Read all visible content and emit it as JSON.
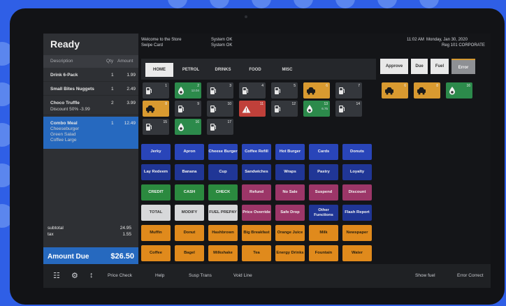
{
  "status": "Ready",
  "header": {
    "welcome": "Welcome to the Store",
    "swipe": "Swipe Card",
    "sys1": "System OK",
    "sys2": "System OK",
    "time": "11:02 AM",
    "date": "Monday, Jan 30, 2020",
    "register": "Reg 101 CORPORATE"
  },
  "receipt": {
    "columns": {
      "description": "Description",
      "qty": "Qty",
      "amount": "Amount"
    },
    "lines": [
      {
        "description": "Drink 6-Pack",
        "qty": "1",
        "amount": "1.99"
      },
      {
        "description": "Small Bites Nuggets",
        "qty": "1",
        "amount": "2.49"
      },
      {
        "description": "Choco Truffle",
        "sub": "Discount 50% -3.99",
        "qty": "2",
        "amount": "3.99"
      },
      {
        "description": "Combo Meal",
        "subs": [
          "Cheeseburger",
          "Green Salad",
          "Coffee Large"
        ],
        "qty": "1",
        "amount": "12.49"
      }
    ],
    "subtotal_label": "subtotal",
    "subtotal": "24.95",
    "tax_label": "tax",
    "tax": "1.55",
    "amount_due_label": "Amount Due",
    "amount_due": "$26.50"
  },
  "tabs": [
    "HOME",
    "PETROL",
    "DRINKS",
    "FOOD",
    "MISC"
  ],
  "pumps": [
    {
      "num": "1",
      "state": "idle"
    },
    {
      "num": "2",
      "amount": "12.04",
      "state": "green"
    },
    {
      "num": "3",
      "state": "idle"
    },
    {
      "num": "4",
      "state": "idle"
    },
    {
      "num": "5",
      "state": "idle"
    },
    {
      "num": "6",
      "state": "yellow"
    },
    {
      "num": "7",
      "state": "idle"
    },
    {
      "num": "8",
      "state": "yellow"
    },
    {
      "num": "9",
      "state": "idle"
    },
    {
      "num": "10",
      "state": "idle"
    },
    {
      "num": "11",
      "state": "red"
    },
    {
      "num": "12",
      "state": "idle"
    },
    {
      "num": "13",
      "amount": "6.75",
      "state": "green"
    },
    {
      "num": "14",
      "state": "idle"
    },
    {
      "num": "15",
      "state": "idle"
    },
    {
      "num": "16",
      "state": "green"
    },
    {
      "num": "17",
      "state": "idle"
    }
  ],
  "grid": {
    "row1": [
      "Jerky",
      "Apron",
      "Cheese Burger",
      "Coffee Refill",
      "Hot Burger",
      "Cards",
      "Donuts"
    ],
    "row2": [
      "Lay Redeem",
      "Banana",
      "Cup",
      "Sandwiches",
      "Wraps",
      "Pastry",
      "Loyalty"
    ],
    "row3": [
      "CREDIT",
      "CASH",
      "CHECK",
      "Refund",
      "No Sale",
      "Suspend",
      "Discount"
    ],
    "row4": [
      "TOTAL",
      "MODIFY",
      "FUEL PREPAY",
      "Price Override",
      "Safe Drop",
      "Other Functions",
      "Flash Report"
    ],
    "row5": [
      "Muffin",
      "Donut",
      "Hashbrown",
      "Big Breakfast",
      "Orange Juice",
      "Milk",
      "Newspaper"
    ],
    "row6": [
      "Coffee",
      "Bagel",
      "Milkshake",
      "Tea",
      "Energy Drinks",
      "Fountain",
      "Water"
    ]
  },
  "right_tabs": [
    "Approve",
    "Due",
    "Fuel",
    "Error"
  ],
  "right_pumps": [
    {
      "num": "6",
      "state": "yellow"
    },
    {
      "num": "8",
      "state": "yellow"
    },
    {
      "num": "16",
      "state": "green"
    }
  ],
  "footer": {
    "price_check": "Price Check",
    "help": "Help",
    "susp_trans": "Susp Trans",
    "void_line": "Void Line",
    "show_fuel": "Show fuel",
    "error_correct": "Error Correct"
  },
  "colors": {
    "background": "#2f5fe6",
    "accent": "#2669bf",
    "pending": "#d99a30",
    "active": "#2c8a4b",
    "alert": "#c0403a"
  }
}
